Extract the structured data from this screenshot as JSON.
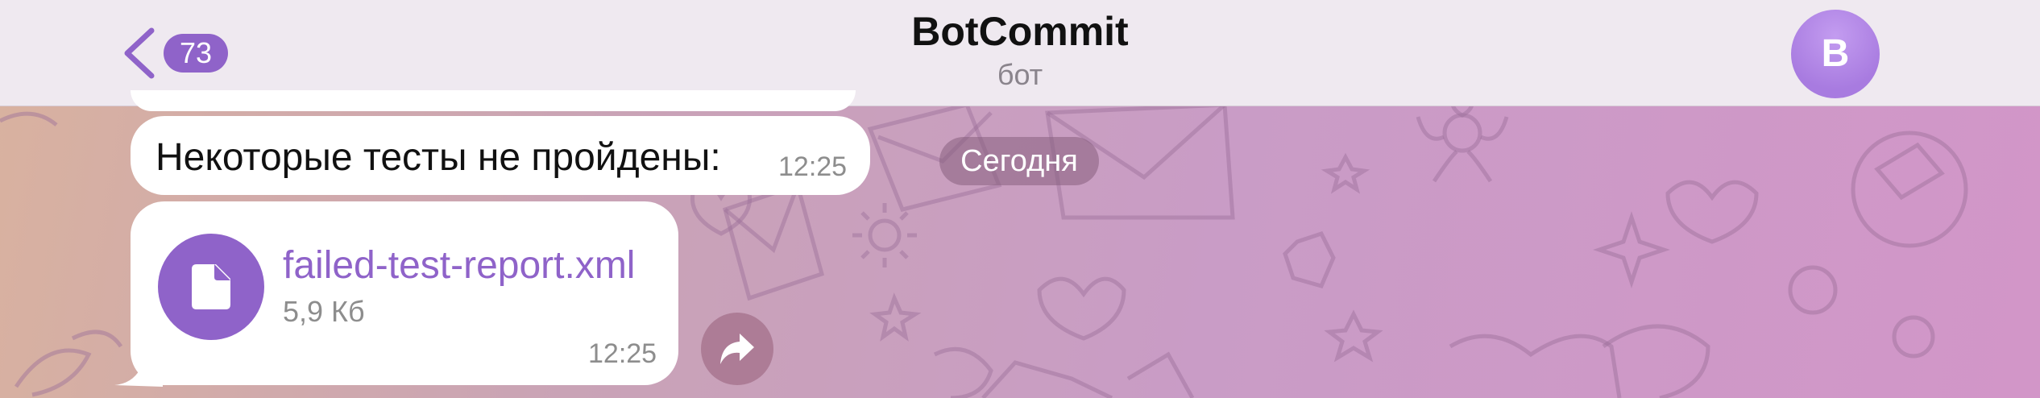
{
  "header": {
    "unread_count": "73",
    "title": "BotCommit",
    "subtitle": "бот",
    "avatar_letter": "B",
    "back_icon": "chevron-left-icon"
  },
  "chat": {
    "date_separator": "Сегодня",
    "messages": [
      {
        "type": "text",
        "text": "Некоторые тесты не пройдены:",
        "time": "12:25"
      },
      {
        "type": "file",
        "file_name": "failed-test-report.xml",
        "file_size": "5,9 Кб",
        "time": "12:25",
        "icon": "document-icon"
      }
    ],
    "forward_icon": "forward-arrow-icon"
  },
  "colors": {
    "accent": "#8f63c9",
    "header_bg": "#efe9f0",
    "bubble_bg": "#ffffff"
  }
}
